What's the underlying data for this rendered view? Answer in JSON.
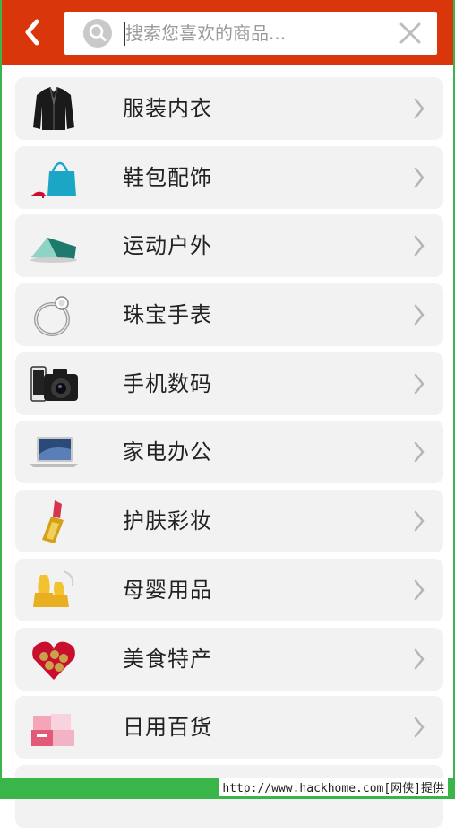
{
  "header": {
    "back_icon": "chevron-left-icon",
    "search_placeholder": "搜索您喜欢的商品...",
    "search_icon": "search-icon",
    "clear_icon": "close-icon",
    "colors": {
      "bar": "#d9360b",
      "frame": "#39b54a"
    }
  },
  "categories": [
    {
      "label": "服装内衣",
      "icon": "jacket-icon"
    },
    {
      "label": "鞋包配饰",
      "icon": "handbag-icon"
    },
    {
      "label": "运动户外",
      "icon": "tent-icon"
    },
    {
      "label": "珠宝手表",
      "icon": "ring-icon"
    },
    {
      "label": "手机数码",
      "icon": "camera-icon"
    },
    {
      "label": "家电办公",
      "icon": "laptop-icon"
    },
    {
      "label": "护肤彩妆",
      "icon": "lipstick-icon"
    },
    {
      "label": "母婴用品",
      "icon": "baby-bottle-icon"
    },
    {
      "label": "美食特产",
      "icon": "chocolate-box-icon"
    },
    {
      "label": "日用百货",
      "icon": "daily-goods-icon"
    }
  ],
  "watermark": "http://www.hackhome.com[网侠]提供"
}
